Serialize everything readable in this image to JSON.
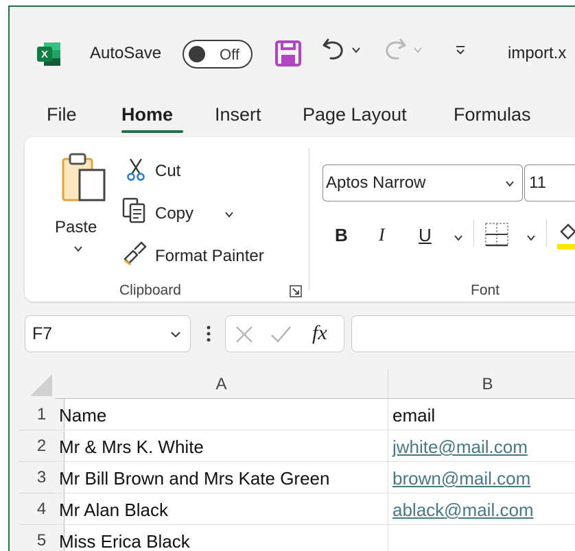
{
  "title_bar": {
    "autosave_label": "AutoSave",
    "autosave_state": "Off",
    "filename": "import.x"
  },
  "tabs": [
    {
      "label": "File"
    },
    {
      "label": "Home",
      "active": true
    },
    {
      "label": "Insert"
    },
    {
      "label": "Page Layout"
    },
    {
      "label": "Formulas"
    }
  ],
  "clipboard": {
    "paste_label": "Paste",
    "cut_label": "Cut",
    "copy_label": "Copy",
    "format_painter_label": "Format Painter",
    "group_label": "Clipboard"
  },
  "font": {
    "font_name": "Aptos Narrow",
    "font_size": "11",
    "bold_label": "B",
    "italic_label": "I",
    "underline_label": "U",
    "group_label": "Font"
  },
  "formula_bar": {
    "name_box": "F7",
    "fx_label": "fx",
    "formula": ""
  },
  "sheet": {
    "columns": [
      "A",
      "B"
    ],
    "rows": [
      {
        "num": "1",
        "a": "Name",
        "b": "email",
        "b_link": false
      },
      {
        "num": "2",
        "a": "Mr & Mrs K. White",
        "b": "jwhite@mail.com",
        "b_link": true
      },
      {
        "num": "3",
        "a": "Mr Bill Brown and Mrs Kate Green",
        "b": "brown@mail.com",
        "b_link": true
      },
      {
        "num": "4",
        "a": "Mr Alan Black",
        "b": "ablack@mail.com",
        "b_link": true
      },
      {
        "num": "5",
        "a": "Miss Erica Black",
        "b": "",
        "b_link": false
      }
    ]
  },
  "colors": {
    "accent": "#217346",
    "save_icon": "#b146c2",
    "hyperlink": "#467886",
    "highlight": "#ffe600"
  }
}
